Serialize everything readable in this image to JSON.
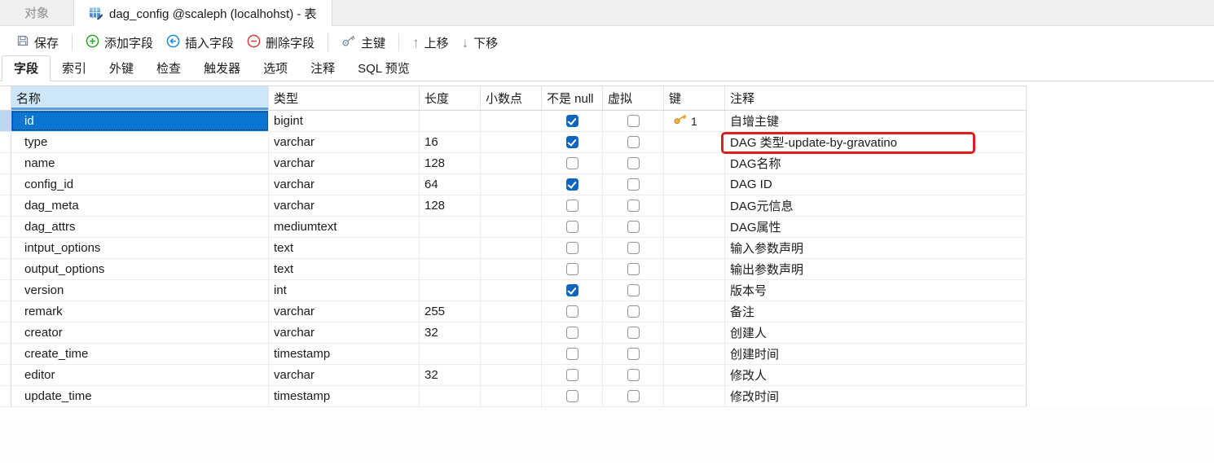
{
  "window": {
    "tabs": [
      {
        "label": "对象",
        "active": false
      },
      {
        "label": "dag_config @scaleph (localhohst) - 表",
        "active": true,
        "icon": "table-edit-icon"
      }
    ]
  },
  "toolbar": {
    "items": [
      {
        "id": "save",
        "label": "保存",
        "icon": "floppy-icon"
      },
      {
        "id": "add-field",
        "label": "添加字段",
        "icon": "plus-circle-icon"
      },
      {
        "id": "insert-field",
        "label": "插入字段",
        "icon": "arrow-left-circle-icon"
      },
      {
        "id": "delete-field",
        "label": "删除字段",
        "icon": "minus-circle-icon"
      },
      {
        "id": "primary-key",
        "label": "主键",
        "icon": "key-icon"
      },
      {
        "id": "move-up",
        "label": "上移",
        "icon": "arrow-up-icon"
      },
      {
        "id": "move-down",
        "label": "下移",
        "icon": "arrow-down-icon"
      }
    ]
  },
  "designer_tabs": {
    "active": "字段",
    "items": [
      "字段",
      "索引",
      "外键",
      "检查",
      "触发器",
      "选项",
      "注释",
      "SQL 预览"
    ]
  },
  "grid": {
    "columns": [
      "名称",
      "类型",
      "长度",
      "小数点",
      "不是 null",
      "虚拟",
      "键",
      "注释"
    ],
    "rows": [
      {
        "name": "id",
        "type": "bigint",
        "length": "",
        "decimal": "",
        "not_null": true,
        "virtual": false,
        "key": "1",
        "comment": "自增主键",
        "selected": true
      },
      {
        "name": "type",
        "type": "varchar",
        "length": "16",
        "decimal": "",
        "not_null": true,
        "virtual": false,
        "key": "",
        "comment": "DAG 类型-update-by-gravatino",
        "comment_highlighted": true
      },
      {
        "name": "name",
        "type": "varchar",
        "length": "128",
        "decimal": "",
        "not_null": false,
        "virtual": false,
        "key": "",
        "comment": "DAG名称"
      },
      {
        "name": "config_id",
        "type": "varchar",
        "length": "64",
        "decimal": "",
        "not_null": true,
        "virtual": false,
        "key": "",
        "comment": "DAG ID"
      },
      {
        "name": "dag_meta",
        "type": "varchar",
        "length": "128",
        "decimal": "",
        "not_null": false,
        "virtual": false,
        "key": "",
        "comment": "DAG元信息"
      },
      {
        "name": "dag_attrs",
        "type": "mediumtext",
        "length": "",
        "decimal": "",
        "not_null": false,
        "virtual": false,
        "key": "",
        "comment": "DAG属性"
      },
      {
        "name": "intput_options",
        "type": "text",
        "length": "",
        "decimal": "",
        "not_null": false,
        "virtual": false,
        "key": "",
        "comment": "输入参数声明"
      },
      {
        "name": "output_options",
        "type": "text",
        "length": "",
        "decimal": "",
        "not_null": false,
        "virtual": false,
        "key": "",
        "comment": "输出参数声明"
      },
      {
        "name": "version",
        "type": "int",
        "length": "",
        "decimal": "",
        "not_null": true,
        "virtual": false,
        "key": "",
        "comment": "版本号"
      },
      {
        "name": "remark",
        "type": "varchar",
        "length": "255",
        "decimal": "",
        "not_null": false,
        "virtual": false,
        "key": "",
        "comment": "备注"
      },
      {
        "name": "creator",
        "type": "varchar",
        "length": "32",
        "decimal": "",
        "not_null": false,
        "virtual": false,
        "key": "",
        "comment": "创建人"
      },
      {
        "name": "create_time",
        "type": "timestamp",
        "length": "",
        "decimal": "",
        "not_null": false,
        "virtual": false,
        "key": "",
        "comment": "创建时间"
      },
      {
        "name": "editor",
        "type": "varchar",
        "length": "32",
        "decimal": "",
        "not_null": false,
        "virtual": false,
        "key": "",
        "comment": "修改人"
      },
      {
        "name": "update_time",
        "type": "timestamp",
        "length": "",
        "decimal": "",
        "not_null": false,
        "virtual": false,
        "key": "",
        "comment": "修改时间"
      }
    ]
  },
  "colors": {
    "selection_blue": "#0a76d1",
    "header_column_highlight": "#cde6f8",
    "checkbox_checked_blue": "#1065c0",
    "primary_key_gold": "#f5b53d",
    "annotation_red": "#e11e1e",
    "add_green": "#27a327",
    "insert_blue": "#1d87da",
    "delete_red": "#d23c3c"
  }
}
